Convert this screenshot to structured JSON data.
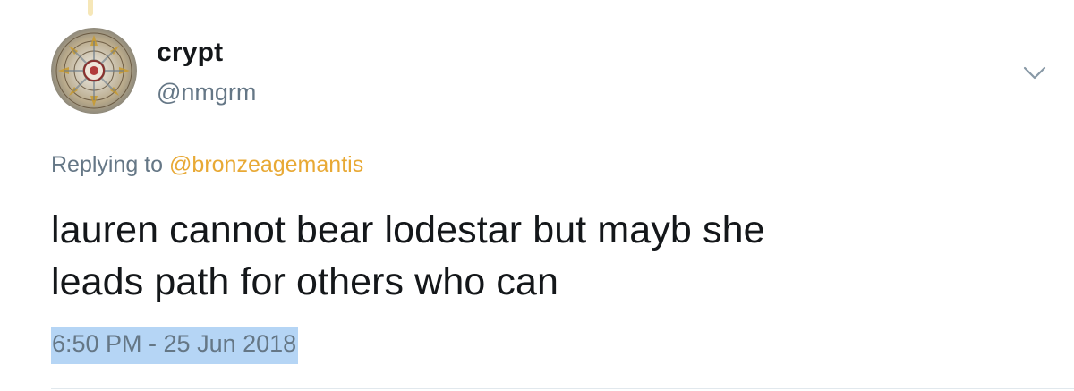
{
  "tweet": {
    "display_name": "crypt",
    "handle": "@nmgrm",
    "reply_prefix": "Replying to",
    "reply_to": "@bronzeagemantis",
    "text_line1": "lauren cannot bear lodestar but mayb she",
    "text_line2": "leads path for others who can",
    "timestamp": "6:50 PM - 25 Jun 2018"
  },
  "icons": {
    "avatar": "mandala-avatar",
    "more": "chevron-down-icon"
  },
  "colors": {
    "text": "#14171a",
    "secondary": "#657786",
    "mention": "#e8a935",
    "selection": "#b5d5f5",
    "thread_line": "#f6e7b8"
  }
}
